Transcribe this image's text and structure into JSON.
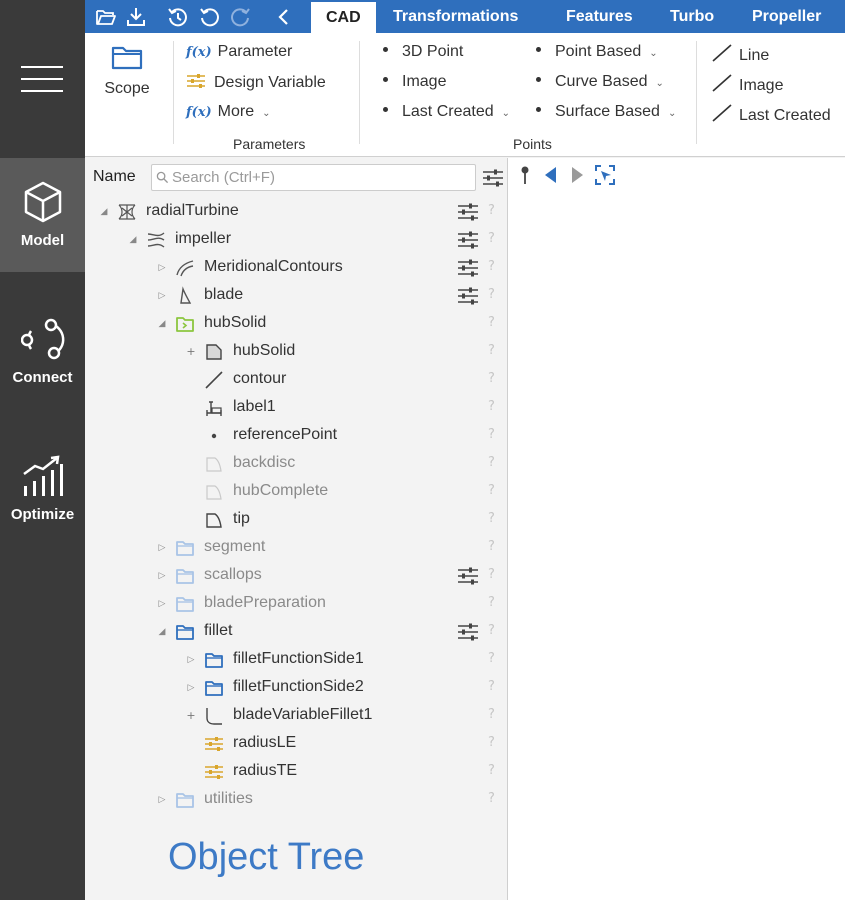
{
  "sidebar": {
    "menu_icon": "hamburger-menu-icon",
    "items": [
      {
        "label": "Model",
        "icon": "cube-icon",
        "active": true
      },
      {
        "label": "Connect",
        "icon": "network-nodes-icon",
        "active": false
      },
      {
        "label": "Optimize",
        "icon": "bar-chart-growth-icon",
        "active": false
      }
    ]
  },
  "toolbar": {
    "icons": [
      "open-folder-icon",
      "download-icon",
      "history-icon",
      "undo-icon",
      "redo-icon",
      "chevron-left-icon"
    ]
  },
  "tabs": [
    "CAD",
    "Transformations",
    "Features",
    "Turbo",
    "Propeller"
  ],
  "active_tab": "CAD",
  "ribbon": {
    "scope": {
      "label": "Scope"
    },
    "parameters": {
      "items": [
        "Parameter",
        "Design Variable",
        "More"
      ],
      "group_label": "Parameters"
    },
    "points": {
      "col1": [
        "3D Point",
        "Image",
        "Last Created"
      ],
      "col2": [
        "Point Based",
        "Curve Based",
        "Surface Based"
      ],
      "group_label": "Points"
    },
    "lines": {
      "items": [
        "Line",
        "Image",
        "Last Created"
      ]
    }
  },
  "tree": {
    "header_label": "Name",
    "search_placeholder": "Search (Ctrl+F)",
    "help_glyph": "?",
    "rows": [
      {
        "label": "radialTurbine",
        "icon": "turbine-model-icon",
        "toggle": "expanded",
        "config": true,
        "dim": false
      },
      {
        "label": "impeller",
        "icon": "impeller-icon",
        "toggle": "expanded",
        "config": true,
        "dim": false
      },
      {
        "label": "MeridionalContours",
        "icon": "meridional-curve-icon",
        "toggle": "collapsed",
        "config": true,
        "dim": false
      },
      {
        "label": "blade",
        "icon": "blade-icon",
        "toggle": "collapsed",
        "config": true,
        "dim": false
      },
      {
        "label": "hubSolid",
        "icon": "green-folder-icon",
        "toggle": "expanded",
        "config": false,
        "dim": false
      },
      {
        "label": "hubSolid",
        "icon": "solid-shape-icon",
        "toggle": "plus",
        "config": false,
        "dim": false
      },
      {
        "label": "contour",
        "icon": "line-icon",
        "toggle": "none",
        "config": false,
        "dim": false
      },
      {
        "label": "label1",
        "icon": "label-icon",
        "toggle": "none",
        "config": false,
        "dim": false
      },
      {
        "label": "referencePoint",
        "icon": "point-icon",
        "toggle": "none",
        "config": false,
        "dim": false
      },
      {
        "label": "backdisc",
        "icon": "surface-icon",
        "toggle": "none",
        "config": false,
        "dim": true
      },
      {
        "label": "hubComplete",
        "icon": "surface-icon",
        "toggle": "none",
        "config": false,
        "dim": true
      },
      {
        "label": "tip",
        "icon": "surface-icon",
        "toggle": "none",
        "config": false,
        "dim": false
      },
      {
        "label": "segment",
        "icon": "folder-icon",
        "toggle": "collapsed",
        "config": false,
        "dim": true
      },
      {
        "label": "scallops",
        "icon": "folder-icon",
        "toggle": "collapsed",
        "config": true,
        "dim": true
      },
      {
        "label": "bladePreparation",
        "icon": "folder-icon",
        "toggle": "collapsed",
        "config": false,
        "dim": true
      },
      {
        "label": "fillet",
        "icon": "folder-icon",
        "toggle": "expanded",
        "config": true,
        "dim": false
      },
      {
        "label": "filletFunctionSide1",
        "icon": "folder-icon",
        "toggle": "collapsed",
        "config": false,
        "dim": false
      },
      {
        "label": "filletFunctionSide2",
        "icon": "folder-icon",
        "toggle": "collapsed",
        "config": false,
        "dim": false
      },
      {
        "label": "bladeVariableFillet1",
        "icon": "fillet-curve-icon",
        "toggle": "plus",
        "config": false,
        "dim": false
      },
      {
        "label": "radiusLE",
        "icon": "design-variable-icon",
        "toggle": "none",
        "config": false,
        "dim": false
      },
      {
        "label": "radiusTE",
        "icon": "design-variable-icon",
        "toggle": "none",
        "config": false,
        "dim": false
      },
      {
        "label": "utilities",
        "icon": "folder-icon",
        "toggle": "collapsed",
        "config": false,
        "dim": true
      }
    ],
    "watermark": "Object Tree"
  },
  "viewer": {
    "icons": [
      "pin-icon",
      "back-arrow-icon",
      "forward-arrow-icon",
      "select-focus-icon"
    ]
  },
  "colors": {
    "accent": "#2f6fbd",
    "sidebar_bg": "#3a3a3a",
    "sidebar_active": "#5a5a5a",
    "design_variable": "#d9a62c",
    "green_folder": "#8cc63f",
    "folder_blue": "#2f6fbd",
    "folder_dim": "#a9c4e6"
  }
}
